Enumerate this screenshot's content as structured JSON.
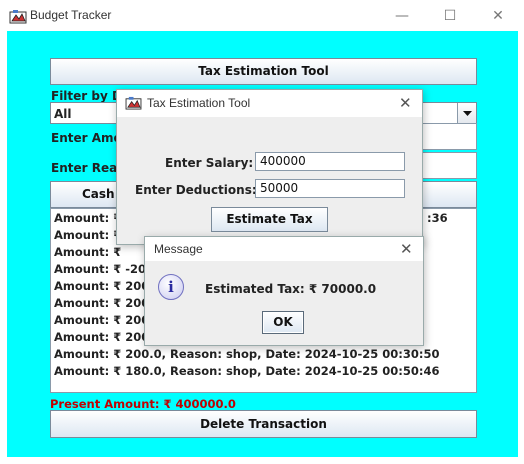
{
  "window": {
    "title": "Budget Tracker",
    "minimize_glyph": "—",
    "maximize_glyph": "☐",
    "close_glyph": "✕",
    "icon": "budget-app-icon"
  },
  "main": {
    "tax_tool_button": "Tax Estimation Tool",
    "filter_label": "Filter by De",
    "filter_value": "All",
    "amount_label": "Enter Amo",
    "reason_label": "Enter Reas",
    "cash_button": "Cash",
    "transactions_partial": [
      "Amount: ₹",
      "Amount: ₹",
      "Amount: ₹",
      "Amount: ₹ -20",
      "Amount: ₹ 200.",
      "Amount: ₹ 2000",
      "Amount: ₹ 200.",
      "Amount: ₹ 2000"
    ],
    "first_row_tail": ":36",
    "transactions_full": [
      "Amount: ₹ 200.0, Reason: shop, Date: 2024-10-25 00:30:50",
      "Amount: ₹ 180.0, Reason: shop, Date: 2024-10-25 00:50:46"
    ],
    "present_amount": "Present Amount: ₹ 400000.0",
    "delete_button": "Delete Transaction",
    "colors": {
      "background": "#00ffff",
      "present_amount": "#c00000"
    }
  },
  "tax_dialog": {
    "title": "Tax Estimation Tool",
    "close_glyph": "✕",
    "salary_label": "Enter Salary:",
    "salary_value": "400000",
    "deductions_label": "Enter Deductions:",
    "deductions_value": "50000",
    "estimate_button": "Estimate Tax"
  },
  "message_dialog": {
    "title": "Message",
    "close_glyph": "✕",
    "icon": "info-icon",
    "icon_glyph": "i",
    "text": "Estimated Tax: ₹ 70000.0",
    "ok_button": "OK"
  }
}
